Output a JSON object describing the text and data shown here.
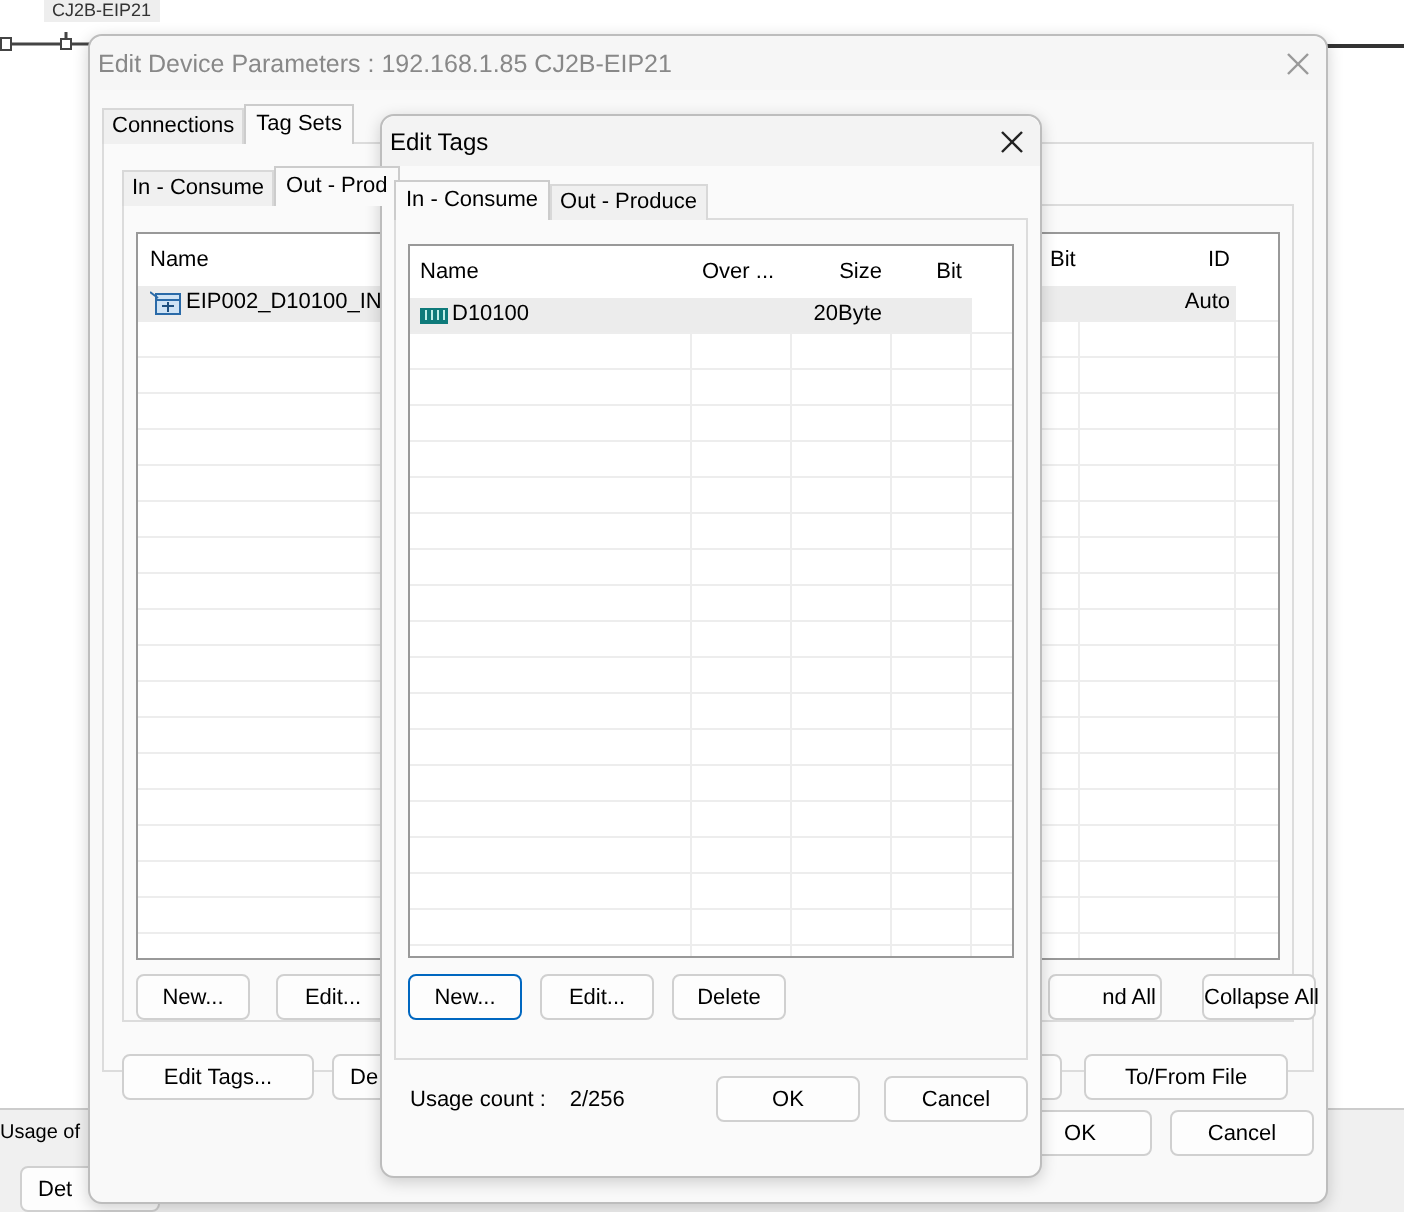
{
  "canvas": {
    "device_label": "CJ2B-EIP21",
    "usage_label": "Usage of",
    "details_button": "Det"
  },
  "main_dialog": {
    "title": "Edit Device Parameters : 192.168.1.85 CJ2B-EIP21",
    "active": false,
    "tabs": [
      {
        "label": "Connections",
        "selected": false
      },
      {
        "label": "Tag Sets",
        "selected": true
      }
    ],
    "sub_tabs": [
      {
        "label": "In - Consume",
        "selected": false
      },
      {
        "label": "Out - Prod",
        "selected": true
      }
    ],
    "table": {
      "columns": [
        "Name",
        "Bit",
        "ID"
      ],
      "rows": [
        {
          "cells": [
            "EIP002_D10100_IN",
            "",
            "Auto"
          ],
          "selected": true
        }
      ]
    },
    "list_buttons": [
      "New...",
      "Edit...",
      "nd All",
      "Collapse All"
    ],
    "panel_buttons": [
      {
        "kind": "text",
        "label": "Edit Tags..."
      },
      {
        "kind": "text",
        "label": "De"
      },
      {
        "kind": "blank"
      },
      {
        "kind": "text",
        "label": "To/From File"
      }
    ],
    "buttons": [
      "OK",
      "Cancel"
    ]
  },
  "edit_tags_dialog": {
    "title": "Edit Tags",
    "active": true,
    "tabs": [
      {
        "label": "In - Consume",
        "selected": true
      },
      {
        "label": "Out - Produce",
        "selected": false
      }
    ],
    "table": {
      "columns": [
        "Name",
        "Over ...",
        "Size",
        "Bit"
      ],
      "rows": [
        {
          "cells": [
            "D10100",
            "",
            "20Byte",
            ""
          ],
          "selected": true
        }
      ]
    },
    "list_buttons": [
      {
        "label": "New...",
        "focused": true
      },
      {
        "label": "Edit...",
        "focused": false
      },
      {
        "label": "Delete",
        "focused": false
      }
    ],
    "usage_label": "Usage count :",
    "usage_value": "2/256",
    "buttons": [
      "OK",
      "Cancel"
    ]
  }
}
